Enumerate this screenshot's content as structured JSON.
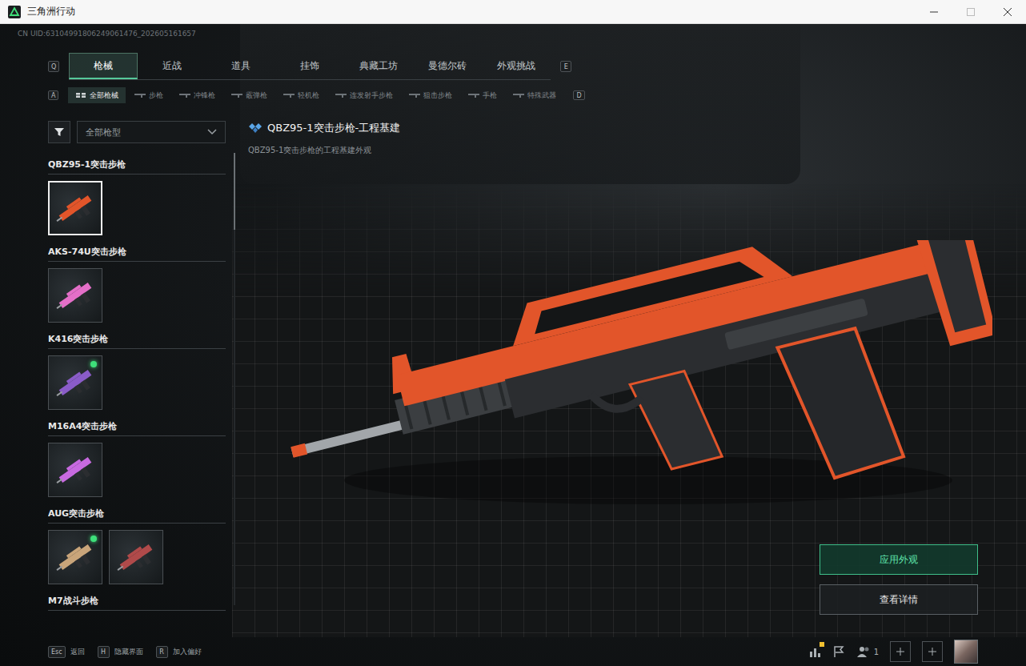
{
  "window": {
    "title": "三角洲行动"
  },
  "uid": "CN UID:63104991806249061476_202605161657",
  "tabs": {
    "prev_key": "Q",
    "next_key": "E",
    "items": [
      {
        "label": "枪械",
        "selected": true
      },
      {
        "label": "近战",
        "selected": false
      },
      {
        "label": "道具",
        "selected": false
      },
      {
        "label": "挂饰",
        "selected": false
      },
      {
        "label": "典藏工坊",
        "selected": false
      },
      {
        "label": "曼德尔砖",
        "selected": false
      },
      {
        "label": "外观挑战",
        "selected": false
      }
    ]
  },
  "subtabs": {
    "prev_key": "A",
    "next_key": "D",
    "items": [
      {
        "label": "全部枪械",
        "selected": true,
        "kind": "all"
      },
      {
        "label": "步枪",
        "selected": false,
        "kind": "weapon"
      },
      {
        "label": "冲锋枪",
        "selected": false,
        "kind": "weapon"
      },
      {
        "label": "霰弹枪",
        "selected": false,
        "kind": "weapon"
      },
      {
        "label": "轻机枪",
        "selected": false,
        "kind": "weapon"
      },
      {
        "label": "连发射手步枪",
        "selected": false,
        "kind": "weapon"
      },
      {
        "label": "狙击步枪",
        "selected": false,
        "kind": "weapon"
      },
      {
        "label": "手枪",
        "selected": false,
        "kind": "weapon"
      },
      {
        "label": "特殊武器",
        "selected": false,
        "kind": "weapon"
      }
    ]
  },
  "filter": {
    "value": "全部枪型"
  },
  "weapons": [
    {
      "name": "QBZ95-1突击步枪",
      "skins": [
        {
          "selected": true,
          "equipped": false,
          "color": "#e2552a"
        }
      ]
    },
    {
      "name": "AKS-74U突击步枪",
      "skins": [
        {
          "selected": false,
          "equipped": false,
          "color": "#e46fc8"
        }
      ]
    },
    {
      "name": "K416突击步枪",
      "skins": [
        {
          "selected": false,
          "equipped": true,
          "color": "#8a5cc8"
        }
      ]
    },
    {
      "name": "M16A4突击步枪",
      "skins": [
        {
          "selected": false,
          "equipped": false,
          "color": "#c86ae0"
        }
      ]
    },
    {
      "name": "AUG突击步枪",
      "skins": [
        {
          "selected": false,
          "equipped": true,
          "color": "#c9a57a"
        },
        {
          "selected": false,
          "equipped": false,
          "color": "#b04a4a"
        }
      ]
    },
    {
      "name": "M7战斗步枪",
      "skins": []
    }
  ],
  "detail": {
    "title": "QBZ95-1突击步枪-工程基建",
    "description": "QBZ95-1突击步枪的工程基建外观"
  },
  "actions": [
    {
      "label": "应用外观",
      "primary": true
    },
    {
      "label": "查看详情",
      "primary": false
    }
  ],
  "hints": [
    {
      "key": "Esc",
      "label": "返回"
    },
    {
      "key": "H",
      "label": "隐藏界面"
    },
    {
      "key": "R",
      "label": "加入偏好"
    }
  ],
  "toolbar": {
    "stats_alert": true,
    "party_count": "1"
  }
}
